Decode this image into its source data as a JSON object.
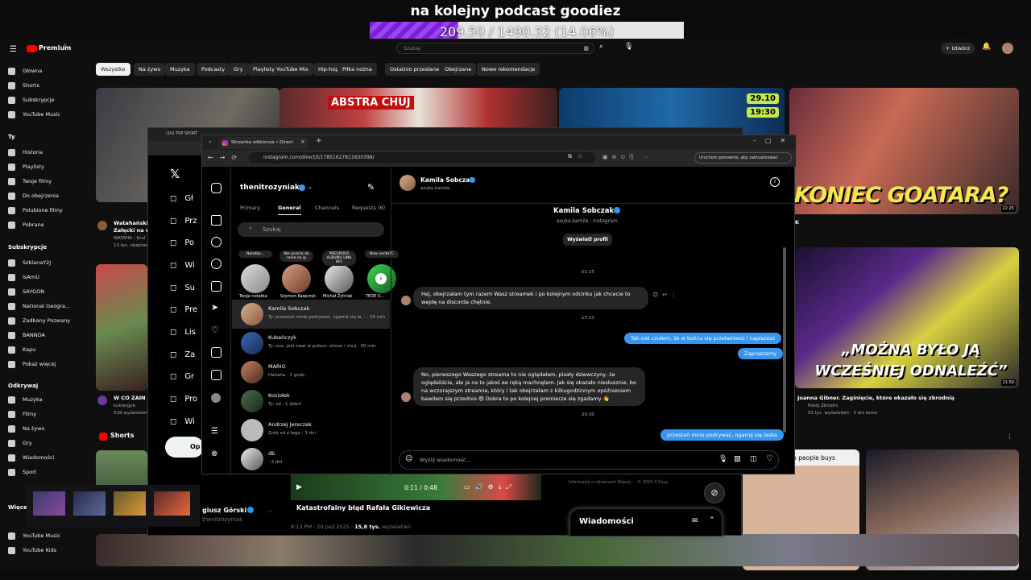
{
  "overlay": {
    "title": "na kolejny podcast goodiez",
    "progress_text": "209.50 / 1490.32 (14.06%)",
    "progress_fraction": 0.1406
  },
  "youtube": {
    "logo": "Premium",
    "logo_sup": "PL",
    "search_placeholder": "Szukaj",
    "create_label": "Utwórz",
    "chips": [
      "Wszystko",
      "Na żywo",
      "Muzyka",
      "Podcasty",
      "Gry",
      "Playlisty YouTube Mix",
      "Hip-hop",
      "Piłka nożna",
      "Ostatnio przesłane",
      "Obejrzane",
      "Nowe rekomendacje"
    ],
    "sidebar_main": [
      "Główna",
      "Shorts",
      "Subskrypcje",
      "YouTube Music"
    ],
    "you_header": "Ty",
    "sidebar_you": [
      "Historia",
      "Playlisty",
      "Twoje filmy",
      "Do obejrzenia",
      "Polubione filmy",
      "Pobrane"
    ],
    "subs_header": "Subskrypcje",
    "sidebar_subs": [
      "SzklanaY2J",
      "IsAmU",
      "SAYGON",
      "National Geogra...",
      "Zadbany Pozwany",
      "BANNDA",
      "Kapu",
      "Pokaż więcej"
    ],
    "explore_header": "Odkrywaj",
    "sidebar_explore": [
      "Muzyka",
      "Filmy",
      "Na żywo",
      "Gry",
      "Wiadomości",
      "Sport"
    ],
    "more_header": "Więcej z",
    "sidebar_more": [
      "YouTube Music",
      "YouTube Kids"
    ],
    "shorts_label": "Shorts",
    "video1": {
      "title": "Wataha​ński F",
      "subtitle": "Załęcki na w",
      "channel": "WATAHA - Krul",
      "meta": "13 tys. obejrzeń"
    },
    "video2": {
      "title": "W CO ZAIN",
      "channel": "kuklargyb",
      "meta": "518 wyświetleń"
    },
    "thumb_time_1": "29.10",
    "thumb_time_2": "19:30",
    "thumb_goat_text": "KONIEC GOATARA?",
    "thumb_quote_text": "„MOŻNA BYŁO JĄ WCZEŚNIEJ ODNALEŹĆ”",
    "thumb_quote_duration": "21:50",
    "thumb_goat_duration": "22:25",
    "right_video": {
      "title": "Joanna Gibner. Zaginięcie, które okazało się zbrodnią",
      "channel": "Pokój Zbrodni",
      "meta": "51 tys. wyświetleń · 3 dni temu"
    },
    "short_text": "is the reason rich people buys",
    "big_k_label": "K"
  },
  "twitter": {
    "nav": [
      "Gł",
      "Prz",
      "Po",
      "Wi",
      "Su",
      "Pre",
      "Lis",
      "Za",
      "Gr",
      "Pro",
      "Wi"
    ],
    "post_button": "Op",
    "author": "giusz Górski",
    "handle": "thenitrozyniak",
    "tweet_title": "Katastrofalny błąd Rafała Gikiewicza",
    "tweet_meta": "8:13 PM · 29 paź 2025 ·",
    "tweet_views": "15,8 tys.",
    "tweet_views_label": "wyświetleń",
    "video_time": "0:11 / 0:48",
    "footer": "Informacja o reklamach   Więcej ···   © 2025 X Corp.",
    "messages_label": "Wiadomości"
  },
  "instagram": {
    "tab_title": "Skrzynka odbiorcza • Direct",
    "tab_title_2": "(10) TVP SPORT",
    "url": "instagram.com/direct/t/17851627811630399/",
    "update_label": "Uruchom ponownie, aby zaktualizować",
    "account": "thenitrozyniak",
    "tabs": [
      "Primary",
      "General",
      "Channels",
      "Requests (6)"
    ],
    "search_placeholder": "Szukaj",
    "notes": [
      {
        "note": "Notatka...",
        "name": "Twoja notatka"
      },
      {
        "note": "Nie piszcie do mnie na ig",
        "name": "Szymon Kasprzyk"
      },
      {
        "note": "PREORDER ALBUMU LINK BIO",
        "name": "Michał Żytniak"
      },
      {
        "note": "Now veritaTC",
        "name": "TEDE V..."
      }
    ],
    "threads": [
      {
        "name": "Kamila Sobczak",
        "sub": "Ty: przestań mnie podrywać, ogarnij się la... · 16 min"
      },
      {
        "name": "Kubańczyk",
        "sub": "Ty: noo, jest cwel w polsce. zimno i chuj · 30 min"
      },
      {
        "name": "MARIO",
        "sub": "Hahaha · 2 godz."
      },
      {
        "name": "Koziołek",
        "sub": "Ty: xd · 1 dzień"
      },
      {
        "name": "Andrzej Jereczek",
        "sub": "Zrób xd z tego · 3 dni"
      },
      {
        "name": "db",
        "sub": "· 3 dni"
      }
    ],
    "chat": {
      "name": "Kamila Sobczak",
      "handle": "asuka.kamila",
      "profile_sub": "asuka.kamila · Instagram",
      "profile_button": "Wyświetl profil",
      "time_1": "01:25",
      "msg_1": "Hej, obejrzałam tym razem Wasz streamek i po kolejnym odcinku jak chcecie to wejdę na discorda chętnie.",
      "time_2": "17:23",
      "msg_2": "Tak coś czułem, że w końcu się przełamiesz i napiszesz",
      "msg_3": "Zapraszamy",
      "msg_4": "No, pierwszego Waszego streama to nie oglądałam, pisały dziewczyny, że oglądaliście, ale ja na to jakoś ee ręką machnęłam. Jak się okazało niesłusznie, bo na wczorajszym streamie, który i tak obejrzałam z kilkugodzinnym opóźnieniem bawiłam się przednio 😄 Dobra to po kolejnej premierze się zgadamy 👋",
      "time_3": "20:30",
      "msg_5": "przestań mnie podrywać, ogarnij się laska",
      "input_placeholder": "Wyślij wiadomość..."
    }
  },
  "colors": {
    "ig_blue": "#3797f0",
    "yt_red": "#ff0000",
    "progress_purple": "#8a2be2"
  }
}
